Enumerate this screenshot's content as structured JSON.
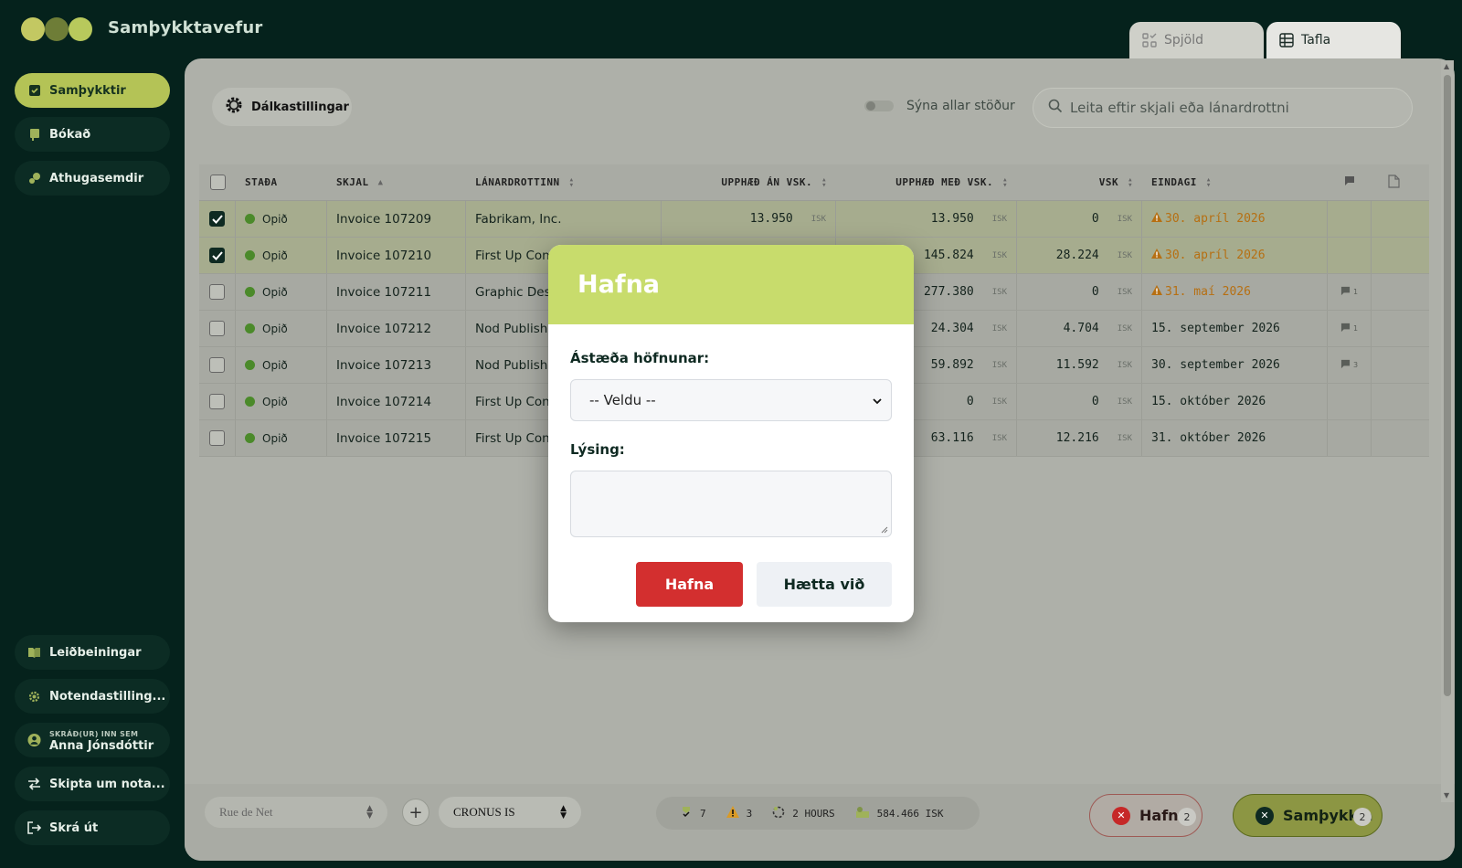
{
  "app": {
    "title": "Samþykktavefur"
  },
  "view_tabs": [
    {
      "label": "Spjöld",
      "icon": "cards-icon"
    },
    {
      "label": "Tafla",
      "icon": "table-icon"
    }
  ],
  "sidebar": {
    "items": [
      {
        "label": "Samþykktir",
        "icon": "check-shield-icon",
        "active": true
      },
      {
        "label": "Bókað",
        "icon": "book-icon"
      },
      {
        "label": "Athugasemdir",
        "icon": "comment-icon"
      }
    ],
    "bottom": {
      "guide": "Leiðbeiningar",
      "settings": "Notendastilling...",
      "logged_in_caption": "SKRÁÐ(UR) INN SEM",
      "user_name": "Anna Jónsdóttir",
      "switch_user": "Skipta um nota...",
      "logout": "Skrá út"
    }
  },
  "toolbar": {
    "column_settings": "Dálkastillingar",
    "show_all_label": "Sýna allar stöður",
    "search_placeholder": "Leita eftir skjali eða lánardrottni"
  },
  "table": {
    "columns": [
      "STAÐA",
      "SKJAL",
      "LÁNARDROTTINN",
      "UPPHÆÐ ÁN VSK.",
      "UPPHÆÐ MEÐ VSK.",
      "VSK",
      "EINDAGI"
    ],
    "rows": [
      {
        "checked": true,
        "status": "Opið",
        "doc": "Invoice 107209",
        "vendor": "Fabrikam, Inc.",
        "net": "13.950",
        "gross": "13.950",
        "vat": "0",
        "due": "30. apríl 2026",
        "overdue": true,
        "comments": ""
      },
      {
        "checked": true,
        "status": "Opið",
        "doc": "Invoice 107210",
        "vendor": "First Up Con",
        "net": "",
        "gross": "145.824",
        "vat": "28.224",
        "due": "30. apríl 2026",
        "overdue": true,
        "comments": ""
      },
      {
        "checked": false,
        "status": "Opið",
        "doc": "Invoice 107211",
        "vendor": "Graphic Des",
        "net": "",
        "gross": "277.380",
        "vat": "0",
        "due": "31. maí 2026",
        "overdue": true,
        "comments": "1"
      },
      {
        "checked": false,
        "status": "Opið",
        "doc": "Invoice 107212",
        "vendor": "Nod Publish",
        "net": "",
        "gross": "24.304",
        "vat": "4.704",
        "due": "15. september 2026",
        "overdue": false,
        "comments": "1"
      },
      {
        "checked": false,
        "status": "Opið",
        "doc": "Invoice 107213",
        "vendor": "Nod Publish",
        "net": "",
        "gross": "59.892",
        "vat": "11.592",
        "due": "30. september 2026",
        "overdue": false,
        "comments": "3"
      },
      {
        "checked": false,
        "status": "Opið",
        "doc": "Invoice 107214",
        "vendor": "First Up Con",
        "net": "",
        "gross": "0",
        "vat": "0",
        "due": "15. október 2026",
        "overdue": false,
        "comments": ""
      },
      {
        "checked": false,
        "status": "Opið",
        "doc": "Invoice 107215",
        "vendor": "First Up Con",
        "net": "",
        "gross": "63.116",
        "vat": "12.216",
        "due": "31. október 2026",
        "overdue": false,
        "comments": ""
      }
    ],
    "currency": "ISK"
  },
  "bottom_bar": {
    "location_select": "Rue de Net",
    "company_select": "CRONUS IS",
    "stats": {
      "approved": "7",
      "warnings": "3",
      "time": "2 HOURS",
      "total": "584.466 ISK"
    },
    "reject_label": "Hafna",
    "reject_count": "2",
    "approve_label": "Samþykkja",
    "approve_count": "2"
  },
  "modal": {
    "title": "Hafna",
    "reason_label": "Ástæða höfnunar:",
    "reason_value": "-- Veldu --",
    "description_label": "Lýsing:",
    "reject_button": "Hafna",
    "cancel_button": "Hætta við"
  },
  "colors": {
    "accent": "#c8dc6c",
    "danger": "#d32f2f",
    "sidebar_bg": "#05221c",
    "warning": "#b66f12",
    "status_open": "#4b8a2a"
  }
}
